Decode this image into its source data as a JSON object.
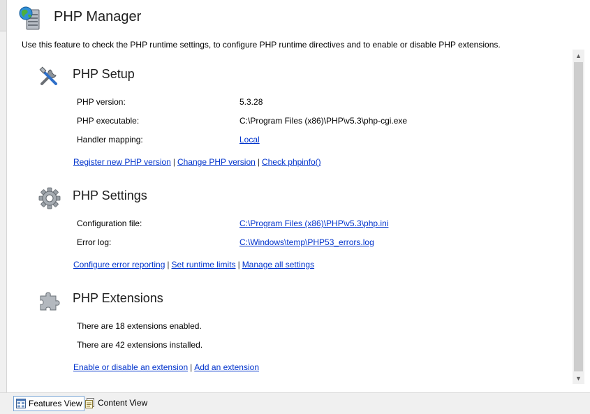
{
  "header": {
    "title": "PHP Manager",
    "description": "Use this feature to check the PHP runtime settings, to configure PHP runtime directives and to enable or disable PHP extensions.",
    "icon": "server-globe-icon"
  },
  "sections": {
    "setup": {
      "title": "PHP Setup",
      "icon": "tools-icon",
      "rows": [
        {
          "label": "PHP version:",
          "value": "5.3.28"
        },
        {
          "label": "PHP executable:",
          "value": "C:\\Program Files (x86)\\PHP\\v5.3\\php-cgi.exe"
        },
        {
          "label": "Handler mapping:",
          "value": "Local"
        }
      ],
      "actions": [
        "Register new PHP version",
        "Change PHP version",
        "Check phpinfo()"
      ]
    },
    "settings": {
      "title": "PHP Settings",
      "icon": "gear-icon",
      "rows": [
        {
          "label": "Configuration file:",
          "value": "C:\\Program Files (x86)\\PHP\\v5.3\\php.ini"
        },
        {
          "label": "Error log:",
          "value": "C:\\Windows\\temp\\PHP53_errors.log"
        }
      ],
      "actions": [
        "Configure error reporting",
        "Set runtime limits",
        "Manage all settings"
      ]
    },
    "extensions": {
      "title": "PHP Extensions",
      "icon": "puzzle-piece-icon",
      "lines": [
        "There are 18 extensions enabled.",
        "There are 42 extensions installed."
      ],
      "actions": [
        "Enable or disable an extension",
        "Add an extension"
      ]
    }
  },
  "views": {
    "features": "Features View",
    "content": "Content View",
    "active": "features"
  },
  "colors": {
    "link": "#0033cc",
    "panel": "#f0f0f0",
    "active_border": "#7aa5d6"
  }
}
